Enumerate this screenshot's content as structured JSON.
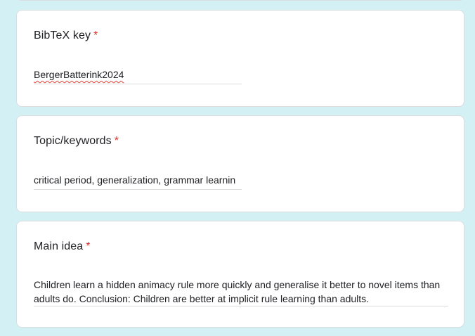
{
  "questions": [
    {
      "title": "BibTeX key",
      "required_mark": "*",
      "answer": "BergerBatterink2024"
    },
    {
      "title": "Topic/keywords",
      "required_mark": "*",
      "answer": "critical period, generalization, grammar learnin"
    },
    {
      "title": "Main idea",
      "required_mark": "*",
      "answer": "Children learn a hidden animacy rule more quickly and generalise it better to novel items than adults do. Conclusion: Children are better at implicit rule learning than adults."
    }
  ],
  "colors": {
    "background": "#d3f1f5",
    "card": "#ffffff",
    "required": "#d93025",
    "text": "#202124",
    "underline": "#dadce0"
  }
}
